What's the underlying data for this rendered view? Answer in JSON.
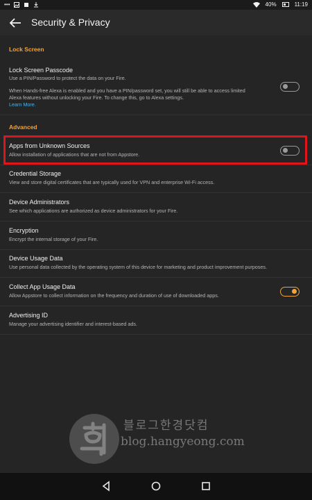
{
  "status_bar": {
    "battery": "40%",
    "time": "11:19",
    "icons": [
      "more-icon",
      "image-icon",
      "notification-icon",
      "download-icon",
      "wifi-icon",
      "battery-icon"
    ]
  },
  "app_bar": {
    "title": "Security & Privacy"
  },
  "sections": {
    "lock_screen": {
      "header": "Lock Screen",
      "passcode": {
        "title": "Lock Screen Passcode",
        "line1": "Use a PIN/Password to protect the data on your Fire.",
        "line2": "When Hands-free Alexa is enabled and you have a PIN/password set, you will still be able to access limited",
        "line3": "Alexa features without unlocking your Fire. To change this, go to Alexa settings.",
        "link": "Learn More.",
        "toggle_on": false
      }
    },
    "advanced": {
      "header": "Advanced",
      "items": [
        {
          "title": "Apps from Unknown Sources",
          "subtitle": "Allow installation of applications that are not from Appstore.",
          "toggle_on": false
        },
        {
          "title": "Credential Storage",
          "subtitle": "View and store digital certificates that are typically used for VPN and enterprise Wi-Fi access."
        },
        {
          "title": "Device Administrators",
          "subtitle": "See which applications are authorized as device administrators for your Fire."
        },
        {
          "title": "Encryption",
          "subtitle": "Encrypt the internal storage of your Fire."
        },
        {
          "title": "Device Usage Data",
          "subtitle": "Use personal data collected by the operating system of this device for marketing and product improvement purposes."
        },
        {
          "title": "Collect App Usage Data",
          "subtitle": "Allow Appstore to collect information on the frequency and duration of use of downloaded apps.",
          "toggle_on": true
        },
        {
          "title": "Advertising ID",
          "subtitle": "Manage your advertising identifier and interest-based ads."
        }
      ]
    }
  },
  "watermark": {
    "hangul": "블로그한경닷컴",
    "url": "blog.hangyeong.com"
  },
  "colors": {
    "accent": "#f2a33a",
    "link": "#4fb3e6",
    "highlight": "#e0141b",
    "background": "#252525"
  }
}
